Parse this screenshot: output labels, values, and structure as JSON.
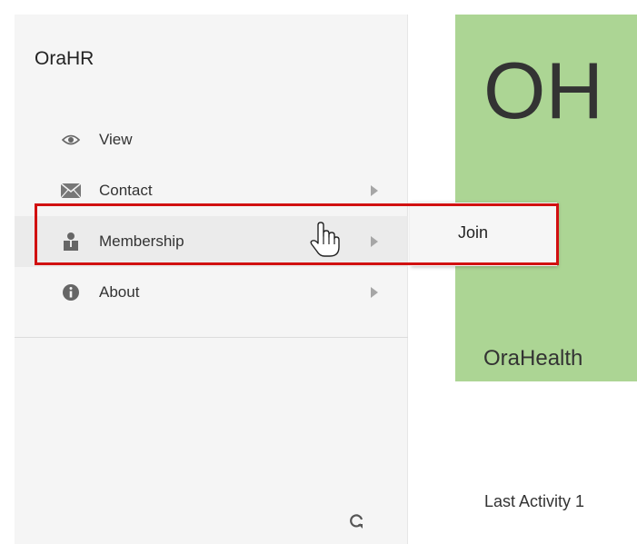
{
  "sidebar": {
    "title": "OraHR",
    "items": [
      {
        "label": "View",
        "icon": "eye-icon",
        "has_submenu": false
      },
      {
        "label": "Contact",
        "icon": "envelope-icon",
        "has_submenu": true
      },
      {
        "label": "Membership",
        "icon": "person-icon",
        "has_submenu": true,
        "active": true
      },
      {
        "label": "About",
        "icon": "info-icon",
        "has_submenu": true
      }
    ],
    "refresh_icon": "refresh-icon"
  },
  "submenu": {
    "items": [
      {
        "label": "Join"
      }
    ]
  },
  "main": {
    "initials": "OH",
    "org_name": "OraHealth",
    "last_activity": "Last Activity 1",
    "hero_color": "#acd594"
  },
  "colors": {
    "highlight": "#d11010",
    "panel_bg": "#f5f5f5"
  }
}
